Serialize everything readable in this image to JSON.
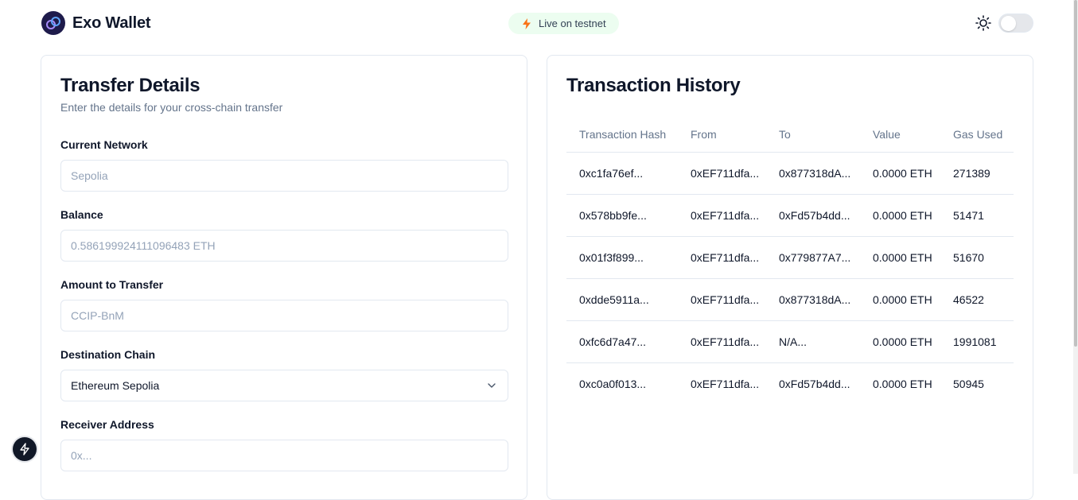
{
  "header": {
    "brand": "Exo Wallet",
    "live_badge": "Live on testnet",
    "logo_icon": "orbit-logo-icon",
    "theme_icon": "sun-icon",
    "accent_color": "#f97316"
  },
  "transfer": {
    "title": "Transfer Details",
    "subtitle": "Enter the details for your cross-chain transfer",
    "fields": {
      "network": {
        "label": "Current Network",
        "value": "Sepolia"
      },
      "balance": {
        "label": "Balance",
        "value": "0.586199924111096483 ETH"
      },
      "amount": {
        "label": "Amount to Transfer",
        "placeholder": "CCIP-BnM"
      },
      "destination": {
        "label": "Destination Chain",
        "value": "Ethereum Sepolia"
      },
      "receiver": {
        "label": "Receiver Address",
        "placeholder": "0x..."
      }
    }
  },
  "history": {
    "title": "Transaction History",
    "columns": [
      "Transaction Hash",
      "From",
      "To",
      "Value",
      "Gas Used"
    ],
    "rows": [
      [
        "0xc1fa76ef...",
        "0xEF711dfa...",
        "0x877318dA...",
        "0.0000 ETH",
        "271389"
      ],
      [
        "0x578bb9fe...",
        "0xEF711dfa...",
        "0xFd57b4dd...",
        "0.0000 ETH",
        "51471"
      ],
      [
        "0x01f3f899...",
        "0xEF711dfa...",
        "0x779877A7...",
        "0.0000 ETH",
        "51670"
      ],
      [
        "0xdde5911a...",
        "0xEF711dfa...",
        "0x877318dA...",
        "0.0000 ETH",
        "46522"
      ],
      [
        "0xfc6d7a47...",
        "0xEF711dfa...",
        "N/A...",
        "0.0000 ETH",
        "1991081"
      ],
      [
        "0xc0a0f013...",
        "0xEF711dfa...",
        "0xFd57b4dd...",
        "0.0000 ETH",
        "50945"
      ]
    ]
  }
}
